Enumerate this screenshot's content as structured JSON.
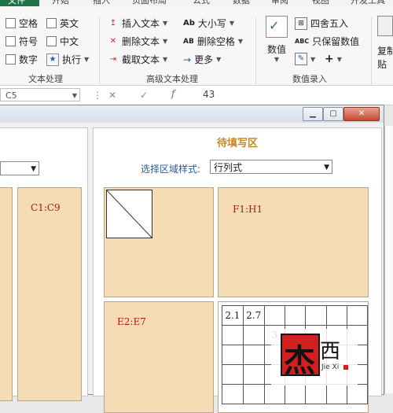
{
  "tabs": {
    "file": "文件",
    "start": "开始",
    "insert": "插入",
    "layout": "页面布局",
    "formula": "公式",
    "data": "数据",
    "review": "审阅",
    "view": "视图",
    "dev": "开发工具"
  },
  "ribbon": {
    "text_group": {
      "label": "文本处理",
      "space": "空格",
      "english": "英文",
      "symbol": "符号",
      "chinese": "中文",
      "digit": "数字",
      "execute": "执行"
    },
    "adv_group": {
      "label": "高级文本处理",
      "insert_text": "插入文本",
      "delete_text": "删除文本",
      "extract_text": "截取文本",
      "case": "大小写",
      "case_prefix": "Ab",
      "delete_space": "删除空格",
      "delete_space_prefix": "AB",
      "more": "更多"
    },
    "num_group": {
      "label": "数值录入",
      "value": "数值",
      "round": "四舍五入",
      "keep_valid": "只保留数值",
      "keep_valid_prefix": "ABC"
    },
    "paste": {
      "copy": "复制",
      "paste": "贴"
    }
  },
  "formula_bar": {
    "namebox": "C5",
    "fx": "f",
    "content": "43"
  },
  "dialog": {
    "right_title": "待填写区",
    "select_label": "选择区域样式:",
    "select_value": "行列式",
    "left_cell": "C1:C9",
    "cell_f1": "F1:H1",
    "cell_e2": "E2:E7",
    "grid_vals": [
      "2.1",
      "2.7"
    ],
    "grid_partial": "3"
  },
  "watermark": {
    "char1": "杰",
    "char2": "西",
    "sub": "Jie Xi"
  }
}
